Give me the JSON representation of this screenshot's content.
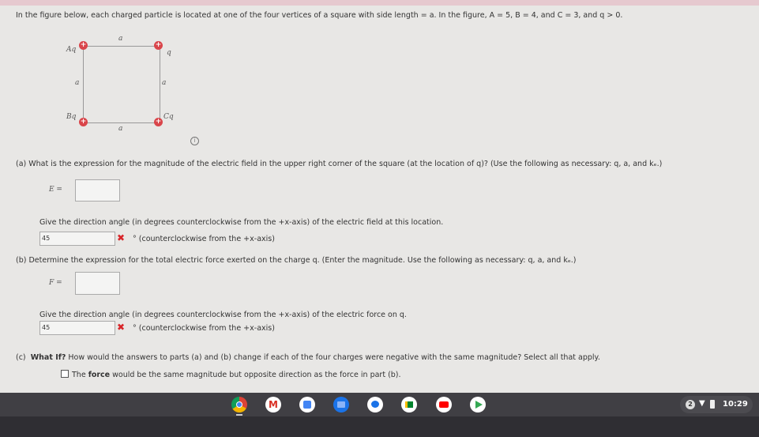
{
  "intro": "In the figure below, each charged particle is located at one of the four vertices of a square with side length = a. In the figure, A = 5, B = 4, and C = 3, and q > 0.",
  "figure": {
    "side_label": "a",
    "top_left": "Aq",
    "top_right": "q",
    "bottom_left": "Bq",
    "bottom_right": "Cq",
    "charge_sign": "+",
    "charge_color": "#d9454a"
  },
  "part_a": {
    "question": "(a)  What is the expression for the magnitude of the electric field in the upper right corner of the square (at the location of q)? (Use the following as necessary: q, a, and kₑ.)",
    "E_label": "E =",
    "E_value": "",
    "direction_prompt": "Give the direction angle (in degrees counterclockwise from the +x-axis) of the electric field at this location.",
    "angle_value": "45",
    "angle_unit": "° (counterclockwise from the +x-axis)",
    "status": "incorrect"
  },
  "part_b": {
    "question": "(b)  Determine the expression for the total electric force exerted on the charge q. (Enter the magnitude. Use the following as necessary: q, a, and kₑ.)",
    "F_label": "F =",
    "F_value": "",
    "direction_prompt": "Give the direction angle (in degrees counterclockwise from the +x-axis) of the electric force on q.",
    "angle_value": "45",
    "angle_unit": "° (counterclockwise from the +x-axis)",
    "status": "incorrect"
  },
  "part_c": {
    "prefix": "(c)",
    "bold": "What If?",
    "question": " How would the answers to parts (a) and (b) change if each of the four charges were negative with the same magnitude? Select all that apply.",
    "options": [
      {
        "pre": "The ",
        "bold": "force",
        "post": " would be the same magnitude but opposite direction as the force in part (b).",
        "checked": false
      }
    ]
  },
  "taskbar": {
    "apps": [
      "chrome-icon",
      "gmail-icon",
      "calendar-icon",
      "files-icon",
      "messages-icon",
      "meet-icon",
      "youtube-icon",
      "play-store-icon"
    ],
    "notification_count": "2",
    "time": "10:29"
  }
}
